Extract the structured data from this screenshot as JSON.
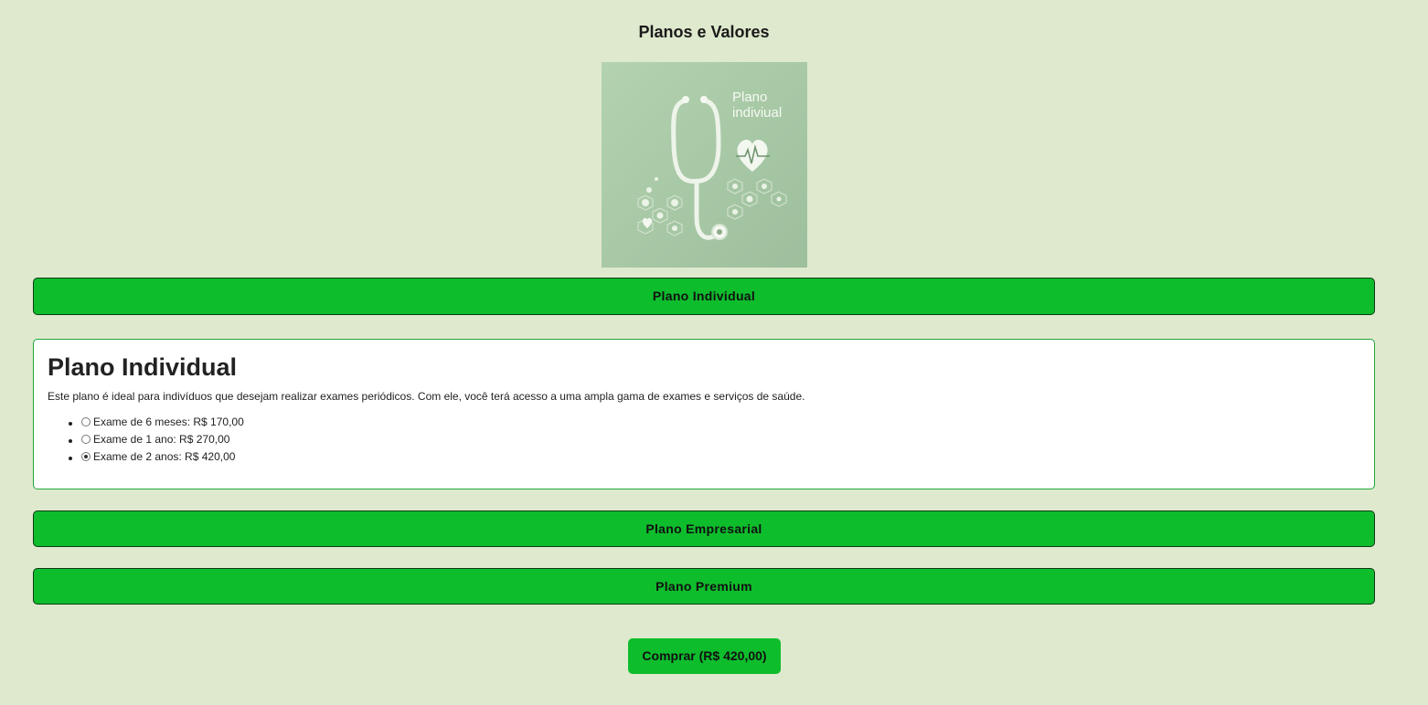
{
  "page": {
    "title": "Planos e Valores"
  },
  "hero_image": {
    "text_line1": "Plano",
    "text_line2": "indiviual",
    "bg_color": "#a9c9a8"
  },
  "accordion": [
    {
      "label": "Plano Individual",
      "expanded": true
    },
    {
      "label": "Plano Empresarial",
      "expanded": false
    },
    {
      "label": "Plano Premium",
      "expanded": false
    }
  ],
  "panel": {
    "heading": "Plano Individual",
    "description": "Este plano é ideal para indivíduos que desejam realizar exames periódicos. Com ele, você terá acesso a uma ampla gama de exames e serviços de saúde.",
    "options": [
      {
        "label": "Exame de 6 meses: R$ 170,00",
        "selected": false
      },
      {
        "label": "Exame de 1 ano: R$ 270,00",
        "selected": false
      },
      {
        "label": "Exame de 2 anos: R$ 420,00",
        "selected": true
      }
    ]
  },
  "buy_button": {
    "label": "Comprar (R$ 420,00)"
  },
  "colors": {
    "background": "#dfe9cd",
    "accent_green": "#0ebd2c",
    "panel_border": "#1ea83a"
  }
}
